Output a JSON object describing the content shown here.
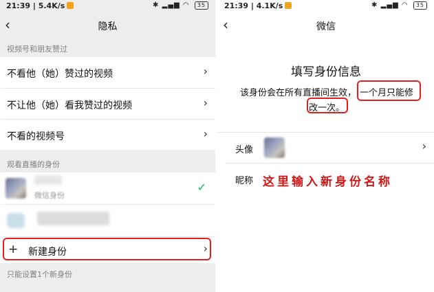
{
  "left": {
    "status": {
      "time": "21:39",
      "speed": "5.4K/s",
      "battery": "35"
    },
    "title": "隐私",
    "section1": "视频号和朋友赞过",
    "rows": [
      "不看他（她）赞过的视频",
      "不让他（她）看我赞过的视频",
      "不看的视频号"
    ],
    "section2": "观看直播的身份",
    "identity_caption": "微信身份",
    "new_identity": "新建身份",
    "footer": "只能设置1个新身份"
  },
  "right": {
    "status": {
      "time": "21:39",
      "speed": "4.1K/s",
      "battery": "35"
    },
    "title": "微信",
    "heading": "填写身份信息",
    "desc_part1": "该身份会在所有直播间生效，",
    "desc_highlight1": "一个月只能修",
    "desc_highlight2": "改一次。",
    "avatar_label": "头像",
    "nickname_label": "昵称",
    "annotation": "这里输入新身份名称"
  },
  "colors": {
    "accent_green": "#07c160",
    "highlight_red": "#e02020"
  }
}
